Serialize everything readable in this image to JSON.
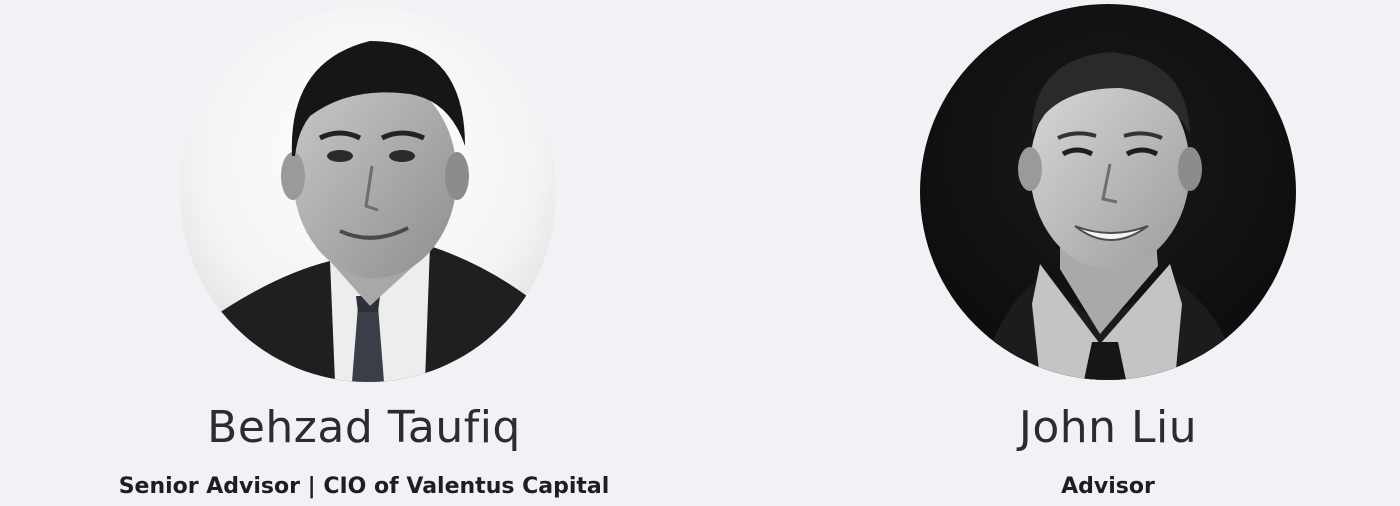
{
  "team": [
    {
      "name": "Behzad Taufiq",
      "role": "Senior Advisor | CIO of Valentus Capital",
      "photo_background": "light"
    },
    {
      "name": "John Liu",
      "role": "Advisor",
      "photo_background": "dark"
    }
  ],
  "colors": {
    "page_background": "#f1f2f6",
    "name_text": "#2b2b30",
    "role_text": "#1e1e22"
  }
}
